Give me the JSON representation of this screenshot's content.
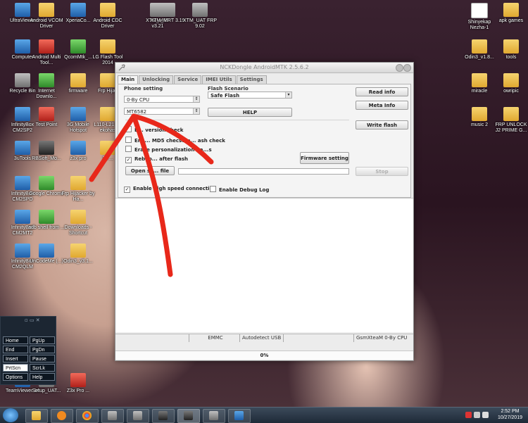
{
  "desktop": {
    "icons": [
      {
        "label": "UltraViewer",
        "kind": "app"
      },
      {
        "label": "Android VCOM Driver",
        "kind": "folder"
      },
      {
        "label": "XperiaCo...",
        "kind": "app"
      },
      {
        "label": "Android CDC Driver",
        "kind": "folder"
      },
      {
        "label": "XTM_MRT v3.21",
        "kind": "game"
      },
      {
        "label": "XTM_MRT 3.19",
        "kind": "game"
      },
      {
        "label": "XTM_UAT FRP 9.02",
        "kind": "game"
      },
      {
        "label": "Computer",
        "kind": "app"
      },
      {
        "label": "Android Multi Tool...",
        "kind": "red"
      },
      {
        "label": "QcomMtk_...",
        "kind": "green"
      },
      {
        "label": "LG Flash Tool 2014",
        "kind": "folder"
      },
      {
        "label": "Recycle Bin",
        "kind": "game"
      },
      {
        "label": "Internet Downlo...",
        "kind": "green"
      },
      {
        "label": "firmware",
        "kind": "folder"
      },
      {
        "label": "Frp Hijac",
        "kind": "folder"
      },
      {
        "label": "InfinityBox CM2SP2",
        "kind": "app"
      },
      {
        "label": "Test Point",
        "kind": "red"
      },
      {
        "label": "3G Mobile Hotspot",
        "kind": "app"
      },
      {
        "label": "L110-L21 ...-ekohas",
        "kind": "folder"
      },
      {
        "label": "3uTools",
        "kind": "app"
      },
      {
        "label": "RBSoft_Mo...",
        "kind": "dark"
      },
      {
        "label": "z3x pro",
        "kind": "app"
      },
      {
        "label": "15 ...",
        "kind": "folder"
      },
      {
        "label": "InfinityBox CM2SPD",
        "kind": "app"
      },
      {
        "label": "Google Chrome",
        "kind": "green"
      },
      {
        "label": "Frp Hijacker by Ha...",
        "kind": "folder"
      },
      {
        "label": "InfinityBox CM2MT2",
        "kind": "app"
      },
      {
        "label": "adb shell from ...",
        "kind": "green"
      },
      {
        "label": "Downloads - Shortcut",
        "kind": "folder"
      },
      {
        "label": "InfinityBox CM2QLM",
        "kind": "app"
      },
      {
        "label": "UnCodeMe (...)",
        "kind": "app"
      },
      {
        "label": "Odin3_v3.1...",
        "kind": "folder"
      },
      {
        "label": "Shinyekap Nezha-1",
        "kind": "paper"
      },
      {
        "label": "apk games",
        "kind": "folder"
      },
      {
        "label": "Odin3_v1.8...",
        "kind": "folder"
      },
      {
        "label": "tools",
        "kind": "folder"
      },
      {
        "label": "miracle",
        "kind": "folder"
      },
      {
        "label": "owripic",
        "kind": "folder"
      },
      {
        "label": "music 2",
        "kind": "folder"
      },
      {
        "label": "FRP UNLOCK J2 PRIME G...",
        "kind": "folder"
      },
      {
        "label": "TeamViewer 14",
        "kind": "app"
      },
      {
        "label": "Setup_UAT...",
        "kind": "game"
      },
      {
        "label": "Z3x Pro ...",
        "kind": "red"
      }
    ]
  },
  "window": {
    "title": "NCKDongle AndroidMTK 2.5.6.2",
    "tabs": [
      "Main",
      "Unlocking",
      "Service",
      "IMEI Utils",
      "Settings"
    ],
    "active_tab": "Main",
    "phone_setting_label": "Phone setting",
    "cpu_select": "0-By CPU",
    "model_input": "MT6582",
    "flash_scenario_label": "Flash Scenario",
    "flash_scenario_value": "Safe Flash",
    "help_button": "HELP",
    "read_info_button": "Read info",
    "meta_info_button": "Meta Info",
    "write_flash_button": "Write flash",
    "firmware_setting_button": "Firmware setting",
    "open_file_button": "Open sc... file",
    "stop_button": "Stop",
    "checks": {
      "verify": {
        "label": "E... version check",
        "checked": false
      },
      "md5": {
        "label": "Ena... MD5 checsum... ash check",
        "checked": false
      },
      "erase": {
        "label": "Erase personalization ha...s",
        "checked": false
      },
      "reboot": {
        "label": "Reboo... after flash",
        "checked": true
      },
      "high_speed": {
        "label": "Enable high speed connection",
        "checked": true
      },
      "debug_log": {
        "label": "Enable Debug Log",
        "checked": false
      }
    },
    "status_bar": [
      "",
      "EMMC",
      "Autodetect USB",
      "",
      "GsmXteaM 0-By CPU"
    ],
    "progress": "0%"
  },
  "keyboard": {
    "keys": [
      "Home",
      "PgUp",
      "End",
      "PgDn",
      "Insert",
      "Pause",
      "PrtScn",
      "ScrLk",
      "Options",
      "Help"
    ],
    "highlighted": "PrtScn"
  },
  "taskbar": {
    "time": "2:52 PM",
    "date": "10/27/2019"
  }
}
